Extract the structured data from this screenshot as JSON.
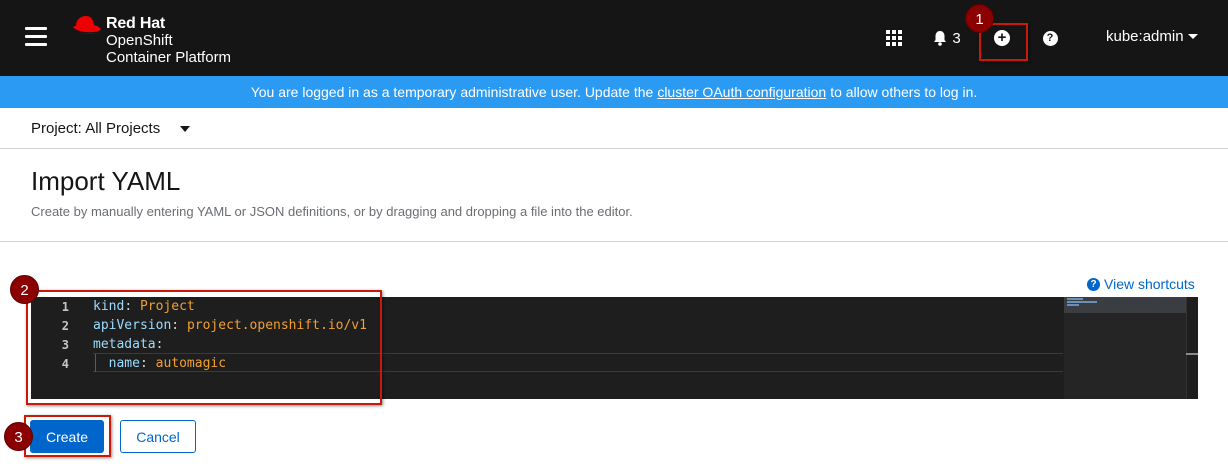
{
  "masthead": {
    "brand": "Red Hat",
    "product_line1": "OpenShift",
    "product_line2": "Container Platform",
    "notifications_count": "3",
    "user": "kube:admin",
    "icons": [
      "hamburger-menu-icon",
      "redhat-hat-logo",
      "app-launcher-icon",
      "bell-icon",
      "plus-circle-icon",
      "question-circle-icon",
      "caret-down-icon"
    ],
    "colors": {
      "background": "#151515",
      "brand_red": "#ee0000"
    }
  },
  "banner": {
    "text_before": "You are logged in as a temporary administrative user. Update the",
    "link": "cluster OAuth configuration",
    "text_after": "to allow others to log in.",
    "color": "#2b9af3"
  },
  "project_selector": {
    "label": "Project: All Projects"
  },
  "page": {
    "title": "Import YAML",
    "description": "Create by manually entering YAML or JSON definitions, or by dragging and dropping a file into the editor.",
    "shortcuts_link": "View shortcuts"
  },
  "editor": {
    "lines": [
      {
        "number": "1",
        "key": "kind",
        "sep": ": ",
        "value": "Project"
      },
      {
        "number": "2",
        "key": "apiVersion",
        "sep": ": ",
        "value": "project.openshift.io/v1"
      },
      {
        "number": "3",
        "key": "metadata",
        "sep": ":",
        "value": ""
      },
      {
        "number": "4",
        "key": "  name",
        "sep": ": ",
        "value": "automagic"
      }
    ]
  },
  "actions": {
    "create_label": "Create",
    "cancel_label": "Cancel",
    "primary_color": "#0066cc"
  },
  "annotations": {
    "step1": "1",
    "step2": "2",
    "step3": "3",
    "color": "#c9190b"
  }
}
